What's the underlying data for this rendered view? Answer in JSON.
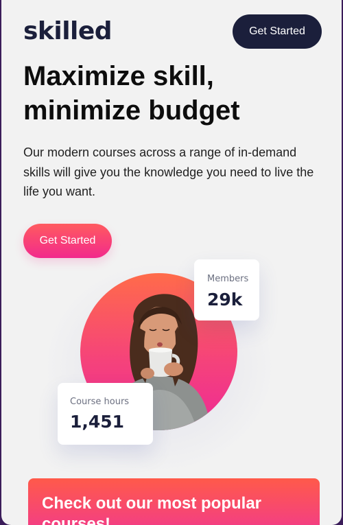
{
  "header": {
    "brand": "skilled",
    "cta_label": "Get Started"
  },
  "hero": {
    "headline": "Maximize skill, minimize budget",
    "intro": "Our modern courses across a range of in-demand skills will give you the knowledge you need to live the life you want.",
    "cta_label": "Get Started"
  },
  "stats": {
    "members": {
      "label": "Members",
      "value": "29k"
    },
    "course_hours": {
      "label": "Course hours",
      "value": "1,451"
    }
  },
  "courses": {
    "title": "Check out our most popular courses!"
  },
  "colors": {
    "navy": "#1b1f3b",
    "gradient_start": "#ff5a5f",
    "gradient_end": "#f22a8c",
    "background": "#f2f2f2"
  }
}
